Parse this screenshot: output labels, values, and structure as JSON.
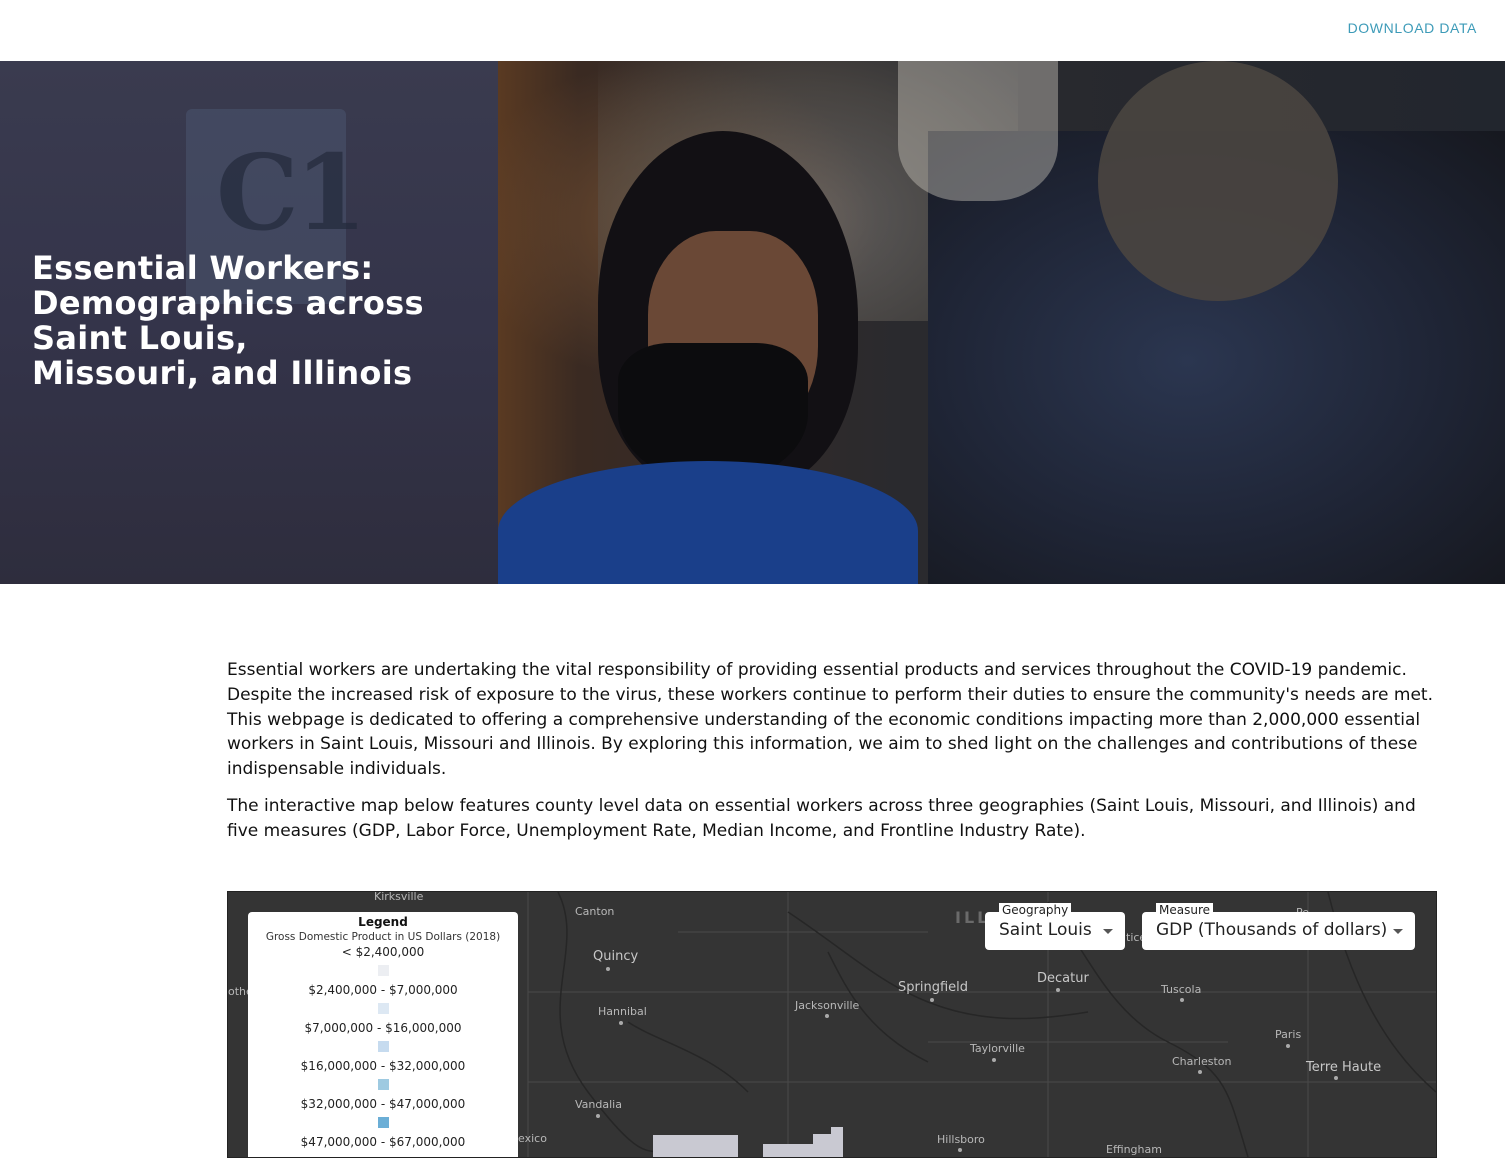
{
  "header": {
    "download_label": "DOWNLOAD DATA"
  },
  "hero": {
    "title_lines": [
      "Essential Workers:",
      "Demographics across",
      "Saint Louis,",
      "Missouri, and Illinois"
    ],
    "logo_text": "C1"
  },
  "intro": {
    "paragraphs": [
      "Essential workers are undertaking the vital responsibility of providing essential products and services throughout the COVID-19 pandemic. Despite the increased risk of exposure to the virus, these workers continue to perform their duties to ensure the community's needs are met. This webpage is dedicated to offering a comprehensive understanding of the economic conditions impacting more than 2,000,000 essential workers in Saint Louis, Missouri and Illinois. By exploring this information, we aim to shed light on the challenges and contributions of these indispensable individuals.",
      "The interactive map below features county level data on essential workers across three geographies (Saint Louis, Missouri, and Illinois) and five measures (GDP, Labor Force, Unemployment Rate, Median Income, and Frontline Industry Rate)."
    ]
  },
  "map": {
    "legend": {
      "title": "Legend",
      "subtitle": "Gross Domestic Product in US Dollars (2018)",
      "bins": [
        {
          "label": "< $2,400,000",
          "color": "#eceef2"
        },
        {
          "label": "$2,400,000 - $7,000,000",
          "color": "#dde8f3"
        },
        {
          "label": "$7,000,000 - $16,000,000",
          "color": "#c6dbef"
        },
        {
          "label": "$16,000,000 - $32,000,000",
          "color": "#9ecae1"
        },
        {
          "label": "$32,000,000 - $47,000,000",
          "color": "#6baed6"
        },
        {
          "label": "$47,000,000 - $67,000,000",
          "color": "#4292c6"
        }
      ]
    },
    "geography": {
      "label": "Geography",
      "value": "Saint Louis"
    },
    "measure": {
      "label": "Measure",
      "value": "GDP (Thousands of dollars)"
    },
    "places": {
      "kirksville": "Kirksville",
      "canton": "Canton",
      "quincy": "Quincy",
      "hannibal": "Hannibal",
      "jacksonville": "Jacksonville",
      "springfield": "Springfield",
      "decatur": "Decatur",
      "tuscola": "Tuscola",
      "taylorville": "Taylorville",
      "paris": "Paris",
      "charleston": "Charleston",
      "terre_haute": "Terre Haute",
      "vandalia": "Vandalia",
      "hillsboro": "Hillsboro",
      "effingham": "Effingham",
      "mexico": "exico",
      "other": "othe",
      "state_il": "ILL",
      "partial_tice": "tice",
      "partial_top": "Pe"
    }
  }
}
